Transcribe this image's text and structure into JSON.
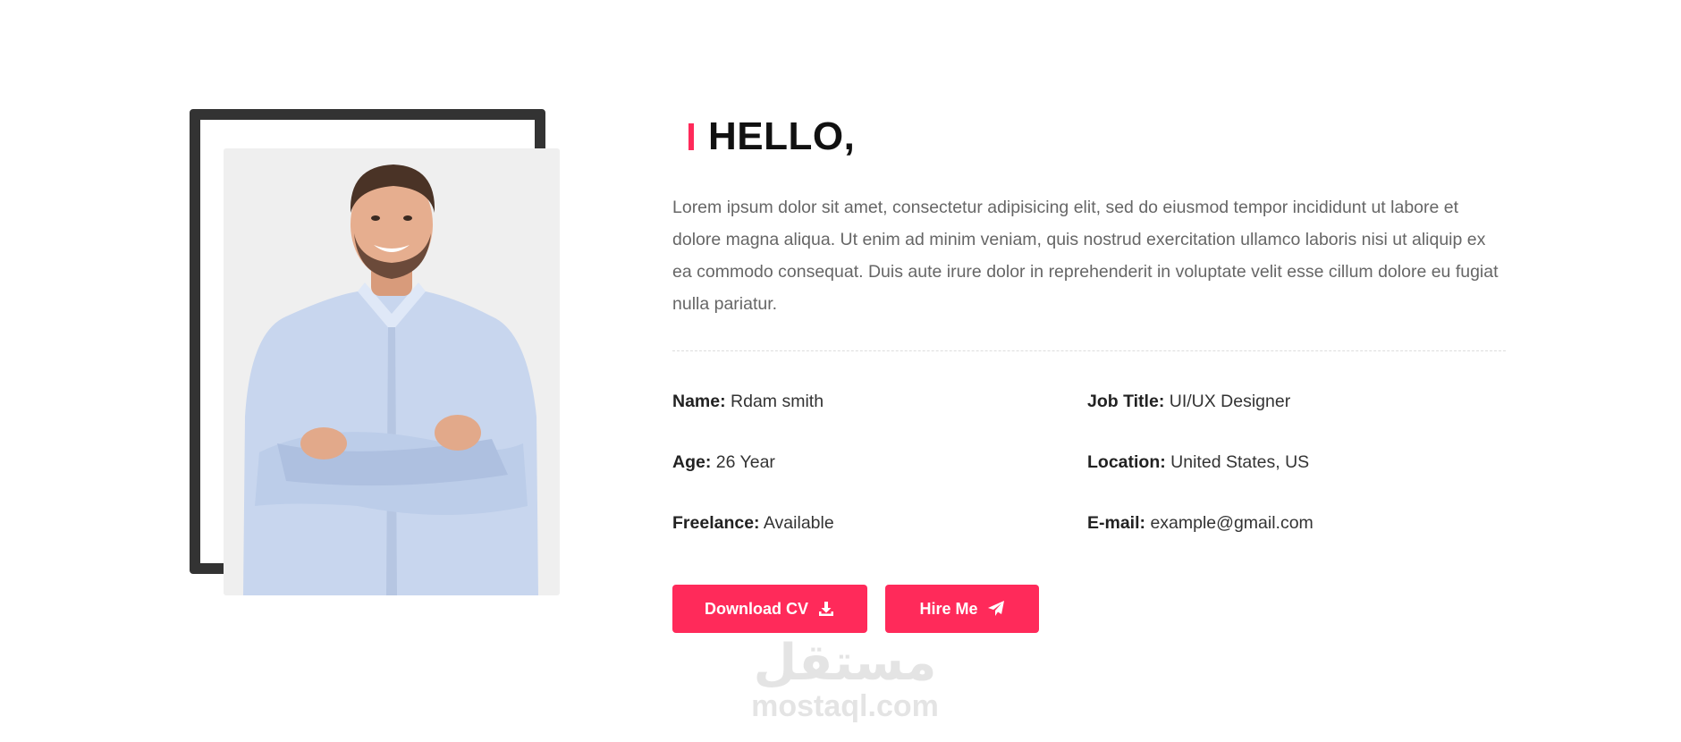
{
  "about": {
    "heading": "HELLO,",
    "intro": "Lorem ipsum dolor sit amet, consectetur adipisicing elit, sed do eiusmod tempor incididunt ut labore et dolore magna aliqua. Ut enim ad minim veniam, quis nostrud exercitation ullamco laboris nisi ut aliquip ex ea commodo consequat. Duis aute irure dolor in reprehenderit in voluptate velit esse cillum dolore eu fugiat nulla pariatur.",
    "info": [
      {
        "label": "Name:",
        "value": "Rdam smith"
      },
      {
        "label": "Job Title:",
        "value": "UI/UX Designer"
      },
      {
        "label": "Age:",
        "value": "26 Year"
      },
      {
        "label": "Location:",
        "value": "United States, US"
      },
      {
        "label": "Freelance:",
        "value": "Available"
      },
      {
        "label": "E-mail:",
        "value": "example@gmail.com"
      }
    ],
    "buttons": {
      "download_label": "Download CV",
      "download_icon": "download-icon",
      "hire_label": "Hire Me",
      "hire_icon": "paper-plane-icon"
    },
    "photo": {
      "subject": "smiling-man-portrait"
    }
  },
  "watermark": {
    "arabic": "مستقل",
    "latin": "mostaql.com"
  },
  "colors": {
    "accent": "#ff2a5a",
    "frame": "#333333",
    "photo_bg": "#efefef",
    "text_muted": "#666666"
  }
}
